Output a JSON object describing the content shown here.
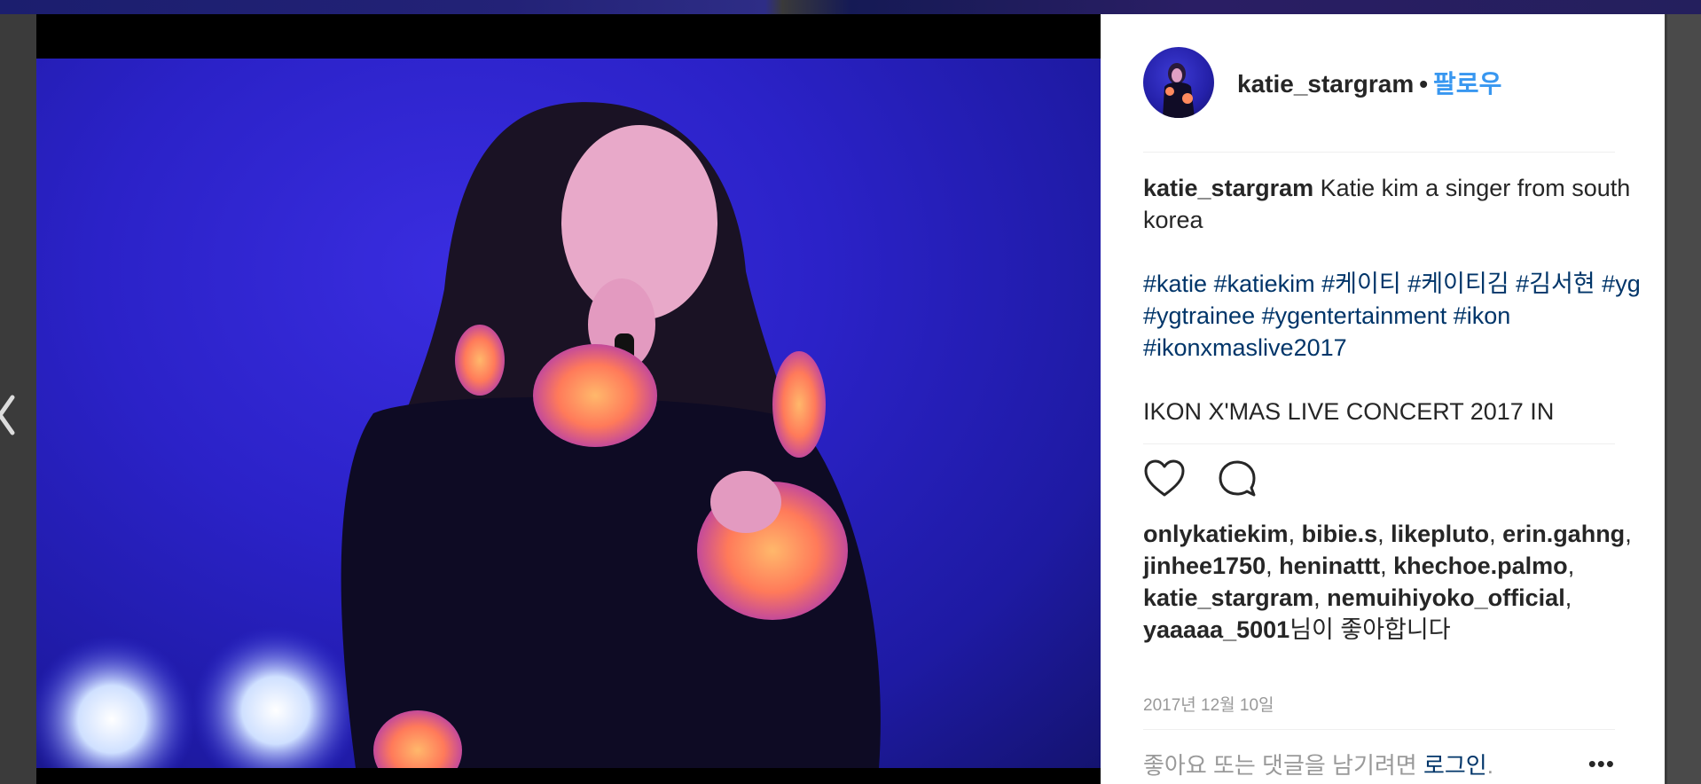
{
  "post": {
    "username": "katie_stargram",
    "separator": "•",
    "follow_label": "팔로우",
    "caption_text": "Katie kim a singer from south korea",
    "hashtags_line": [
      "#katie",
      "#katiekim",
      "#케이티",
      "#케이티김",
      "#김서현",
      "#yg",
      "#ygtrainee",
      "#ygentertainment",
      "#ikon",
      "#ikonxmaslive2017"
    ],
    "caption_more": "IKON X'MAS LIVE CONCERT 2017 IN",
    "liked_by": [
      "onlykatiekim",
      "bibie.s",
      "likepluto",
      "erin.gahng",
      "jinhee1750",
      "heninattt",
      "khechoe.palmo",
      "katie_stargram",
      "nemuihiyoko_official",
      "yaaaaa_5001"
    ],
    "liked_suffix": "님이 좋아합니다",
    "date": "2017년 12월 10일",
    "footer_prompt": "좋아요 또는 댓글을 남기려면",
    "login_label": "로그인",
    "footer_period": "."
  },
  "icons": {
    "like": "heart-icon",
    "comment": "comment-icon",
    "more": "more-options-icon",
    "prev": "chevron-left-icon"
  },
  "colors": {
    "link": "#3897f0",
    "hashtag": "#003569",
    "text": "#262626",
    "muted": "#999999"
  }
}
